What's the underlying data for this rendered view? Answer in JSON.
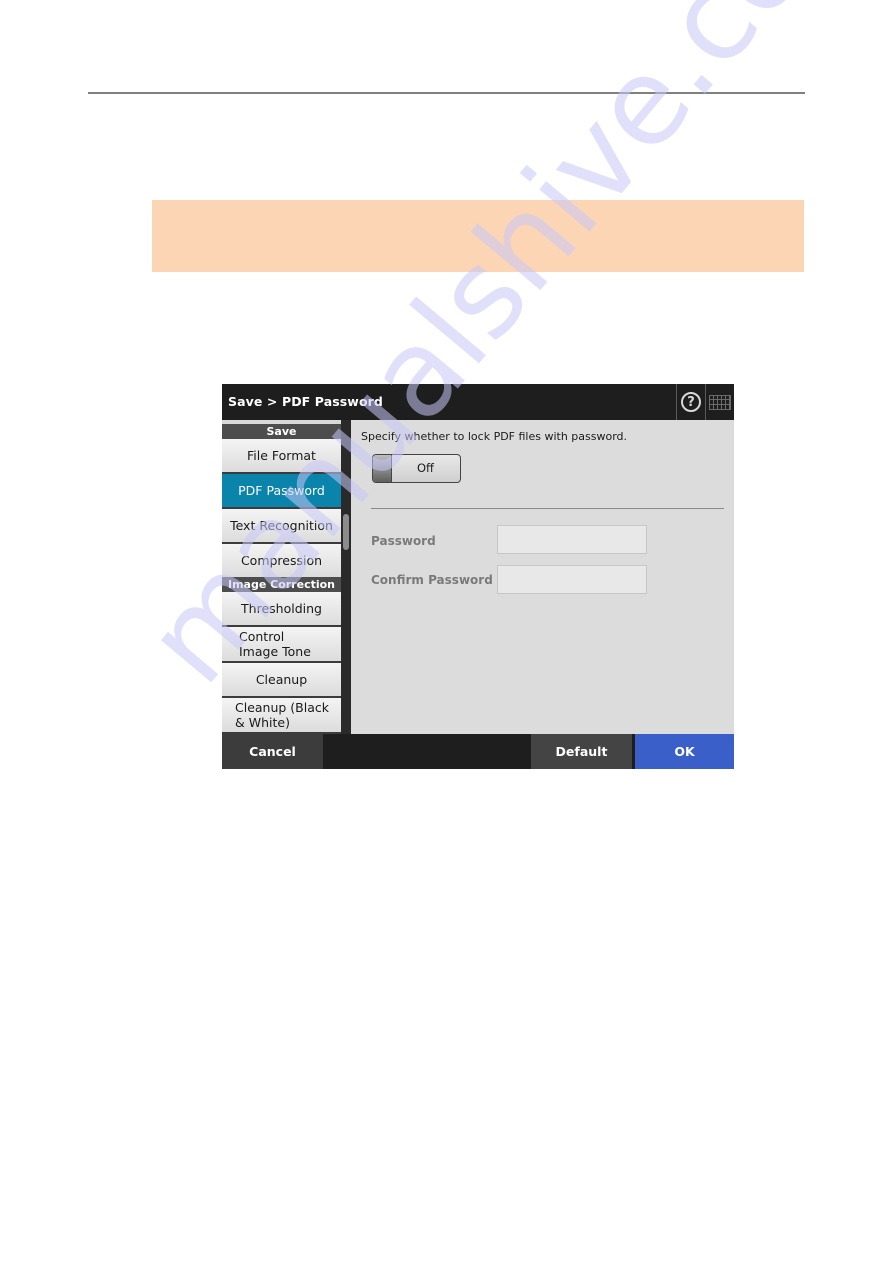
{
  "document": {
    "note_box": {
      "color": "#fcd5b5",
      "text": ""
    },
    "watermark": "manualshive.com"
  },
  "screen": {
    "title": "Save > PDF Password",
    "titlebar_icons": [
      "help-icon",
      "keyboard-icon"
    ],
    "help_glyph": "?",
    "sidebar": {
      "sections": [
        {
          "header": "Save",
          "items": [
            {
              "label": "File Format",
              "active": false
            },
            {
              "label": "PDF Password",
              "active": true
            },
            {
              "label": "Text Recognition",
              "active": false
            },
            {
              "label": "Compression",
              "active": false
            }
          ]
        },
        {
          "header": "Image Correction",
          "items": [
            {
              "label": "Thresholding",
              "active": false
            },
            {
              "label": "Control Image Tone",
              "active": false
            },
            {
              "label": "Cleanup",
              "active": false
            },
            {
              "label": "Cleanup (Black & White)",
              "active": false
            }
          ]
        }
      ],
      "active_color": "#0a84aa"
    },
    "content": {
      "prompt": "Specify whether to lock PDF files with password.",
      "toggle": {
        "label": "Off",
        "state": "off"
      },
      "fields": [
        {
          "label": "Password",
          "value": "",
          "enabled": false
        },
        {
          "label": "Confirm Password",
          "value": "",
          "enabled": false
        }
      ]
    },
    "buttons": {
      "cancel": "Cancel",
      "default": "Default",
      "ok": "OK",
      "ok_color": "#3b5fc8"
    }
  }
}
